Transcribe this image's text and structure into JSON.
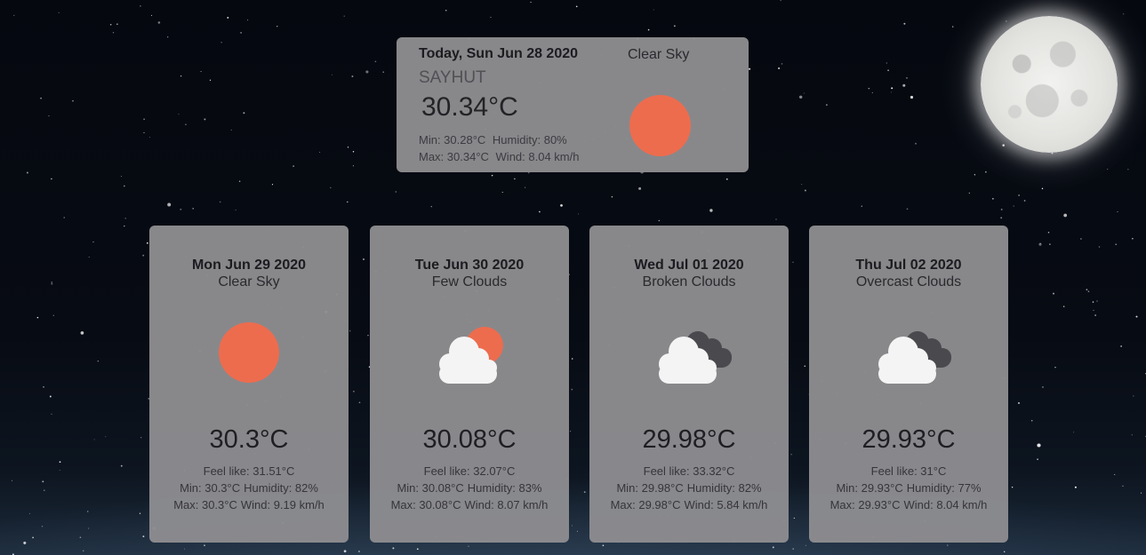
{
  "today": {
    "date": "Today, Sun Jun 28 2020",
    "condition": "Clear Sky",
    "city": "SAYHUT",
    "temp": "30.34°C",
    "min": "Min:  30.28°C",
    "humidity": "Humidity:  80%",
    "max": "Max:  30.34°C",
    "wind": "Wind:  8.04 km/h",
    "icon": "sun-icon"
  },
  "forecast": [
    {
      "date": "Mon Jun 29 2020",
      "condition": "Clear Sky",
      "icon": "sun-icon",
      "temp": "30.3°C",
      "feel": "Feel like: 31.51°C",
      "min": "Min: 30.3°C",
      "humidity": "Humidity: 82%",
      "max": "Max: 30.3°C",
      "wind": "Wind: 9.19 km/h"
    },
    {
      "date": "Tue Jun 30 2020",
      "condition": "Few Clouds",
      "icon": "few-clouds-icon",
      "temp": "30.08°C",
      "feel": "Feel like: 32.07°C",
      "min": "Min: 30.08°C",
      "humidity": "Humidity: 83%",
      "max": "Max: 30.08°C",
      "wind": "Wind: 8.07 km/h"
    },
    {
      "date": "Wed Jul 01 2020",
      "condition": "Broken Clouds",
      "icon": "broken-clouds-icon",
      "temp": "29.98°C",
      "feel": "Feel like: 33.32°C",
      "min": "Min: 29.98°C",
      "humidity": "Humidity: 82%",
      "max": "Max: 29.98°C",
      "wind": "Wind: 5.84 km/h"
    },
    {
      "date": "Thu Jul 02 2020",
      "condition": "Overcast Clouds",
      "icon": "overcast-clouds-icon",
      "temp": "29.93°C",
      "feel": "Feel like: 31°C",
      "min": "Min: 29.93°C",
      "humidity": "Humidity: 77%",
      "max": "Max: 29.93°C",
      "wind": "Wind: 8.04 km/h"
    }
  ],
  "colors": {
    "sun": "#ed6c4e",
    "card": "#8c8c90",
    "cloud_light": "#f4f4f4",
    "cloud_dark": "#4a4a4e"
  }
}
